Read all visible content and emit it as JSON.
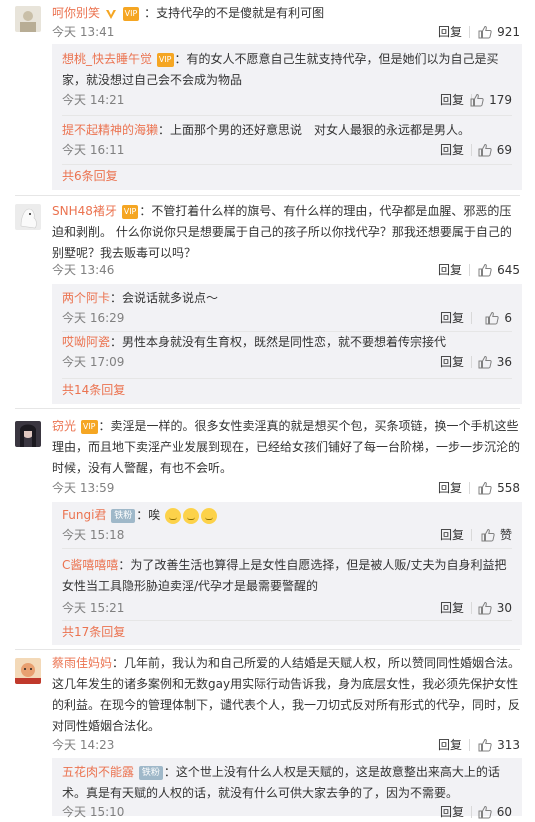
{
  "colors": {
    "name": "#eb7350",
    "text": "#333333",
    "meta": "#808080",
    "subbg": "#f2f2f5"
  },
  "comments": [
    {
      "user": "呵你别笑",
      "verified": true,
      "badge": "VIP",
      "text": "支持代孕的不是傻就是有利可图",
      "time": "今天 13:41",
      "reply": "回复",
      "likes": "921",
      "subs": [
        {
          "user": "想桃_快去睡午觉",
          "badge": "VIP",
          "text": "有的女人不愿意自己生就支持代孕，但是她们以为自己是买家，就没想过自己会不会成为物品",
          "time": "今天 14:21",
          "reply": "回复",
          "likes": "179"
        },
        {
          "user": "提不起精神的海獭",
          "text": "上面那个男的还好意思说　对女人最狠的永远都是男人。",
          "time": "今天 16:11",
          "reply": "回复",
          "likes": "69"
        }
      ],
      "more": "共6条回复"
    },
    {
      "user": "SNH48褚牙",
      "badge": "VIP",
      "text": "不管打着什么样的旗号、有什么样的理由，代孕都是血腥、邪恶的压迫和剥削。 什么你说你只是想要属于自己的孩子所以你找代孕？那我还想要属于自己的别墅呢？我去贩毒可以吗？",
      "time": "今天 13:46",
      "reply": "回复",
      "likes": "645",
      "subs": [
        {
          "user": "两个阿卡",
          "text": "会说话就多说点～",
          "time": "今天 16:29",
          "reply": "回复",
          "likes": "6"
        },
        {
          "user": "哎呦阿瓷",
          "text": "男性本身就没有生育权，既然是同性恋，就不要想着传宗接代",
          "time": "今天 17:09",
          "reply": "回复",
          "likes": "36"
        }
      ],
      "more": "共14条回复"
    },
    {
      "user": "窃光",
      "badge": "VIP",
      "text": "卖淫是一样的。很多女性卖淫真的就是想买个包，买条项链，换一个手机这些理由，而且地下卖淫产业发展到现在，已经给女孩们铺好了每一台阶梯，一步一步沉沦的时候，没有人警醒，有也不会听。",
      "time": "今天 13:59",
      "reply": "回复",
      "likes": "558",
      "subs": [
        {
          "user": "Fungi君",
          "fan": "铁粉",
          "text": "唉",
          "emoji": 3,
          "time": "今天 15:18",
          "reply": "回复",
          "likes": "赞"
        },
        {
          "user": "C酱嘻嘻嘻",
          "text": "为了改善生活也算得上是女性自愿选择，但是被人贩/丈夫为自身利益把女性当工具隐形胁迫卖淫/代孕才是最需要警醒的",
          "time": "今天 15:21",
          "reply": "回复",
          "likes": "30"
        }
      ],
      "more": "共17条回复"
    },
    {
      "user": "蔡雨佳妈妈",
      "text": "几年前，我认为和自己所爱的人结婚是天赋人权，所以赞同同性婚姻合法。这几年发生的诸多案例和无数gay用实际行动告诉我，身为底层女性，我必须先保护女性的利益。在现今的管理体制下，谴代表个人，我一刀切式反对所有形式的代孕，同时，反对同性婚姻合法化。",
      "time": "今天 14:23",
      "reply": "回复",
      "likes": "313",
      "subs": [
        {
          "user": "五花肉不能露",
          "fan": "铁粉",
          "text": "这个世上没有什么人权是天赋的，这是故意整出来高大上的话术。真是有天赋的人权的话，就没有什么可供大家去争的了，因为不需要。",
          "time": "今天 15:10",
          "reply": "回复",
          "likes": "60"
        }
      ]
    }
  ]
}
